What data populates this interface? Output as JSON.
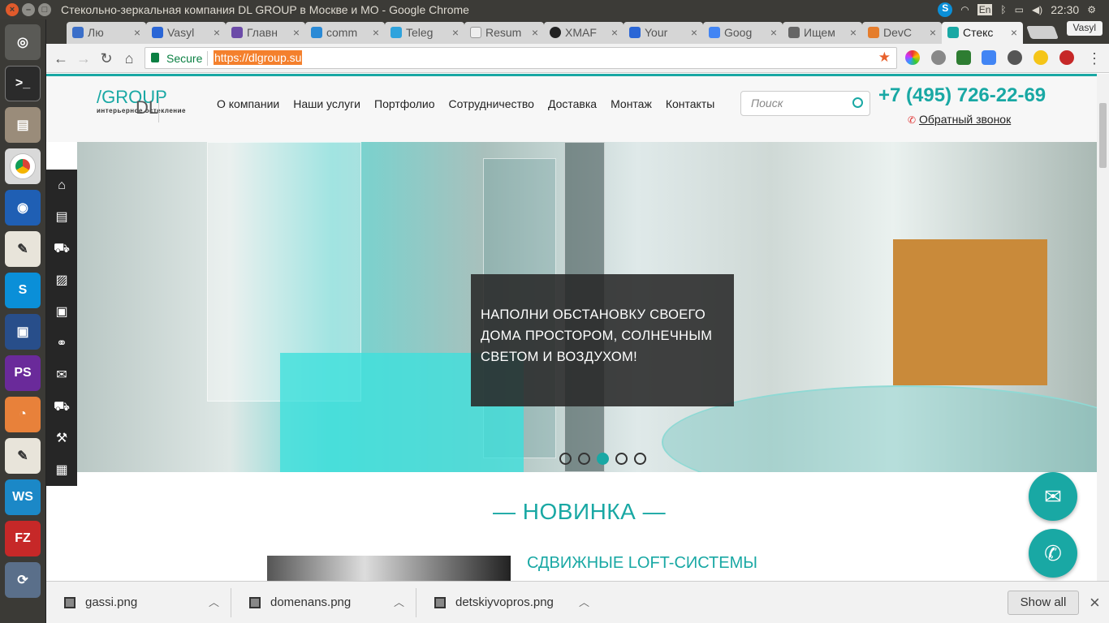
{
  "window": {
    "title": "Стекольно-зеркальная компания DL GROUP в Москве и МО - Google Chrome"
  },
  "tray": {
    "lang": "En",
    "time": "22:30"
  },
  "tabs": [
    {
      "label": "Лю",
      "color": "#3b6fc9"
    },
    {
      "label": "Vasyl",
      "color": "#2a66d6"
    },
    {
      "label": "Главн",
      "color": "#6c4ba8"
    },
    {
      "label": "comm",
      "color": "#2a8ad6"
    },
    {
      "label": "Teleg",
      "color": "#2fa3dd"
    },
    {
      "label": "Resum",
      "color": "#dddddd"
    },
    {
      "label": "XMAF",
      "color": "#222222"
    },
    {
      "label": "Your",
      "color": "#2a66d6"
    },
    {
      "label": "Goog",
      "color": "#4285f4"
    },
    {
      "label": "Ищем",
      "color": "#666666"
    },
    {
      "label": "DevC",
      "color": "#e57d2c"
    },
    {
      "label": "Стекс",
      "color": "#19a8a4"
    }
  ],
  "profile": {
    "name": "Vasyl"
  },
  "omnibox": {
    "secure": "Secure",
    "url": "https://dlgroup.su"
  },
  "site": {
    "logo": {
      "dl": "DL",
      "group": "GROUP",
      "tagline": "интерьерное остекление"
    },
    "menu": [
      "О компании",
      "Наши услуги",
      "Портфолио",
      "Сотрудничество",
      "Доставка",
      "Монтаж",
      "Контакты"
    ],
    "search_placeholder": "Поиск",
    "phone": "+7 (495) 726-22-69",
    "callback": "Обратный звонок",
    "slide_caption": "НАПОЛНИ ОБСТАНОВКУ СВОЕГО ДОМА ПРОСТОРОМ, СОЛНЕЧНЫМ СВЕТОМ И ВОЗДУХОМ!",
    "slider": {
      "slides": 5,
      "active_slide": 3
    },
    "section_title": "— НОВИНКА —",
    "promo_title": "СДВИЖНЫЕ LOFT-СИСТЕМЫ",
    "accent": "#19a8a4"
  },
  "downloads": [
    {
      "name": "gassi.png"
    },
    {
      "name": "domenans.png"
    },
    {
      "name": "detskiyvopros.png"
    }
  ],
  "show_all": "Show all"
}
